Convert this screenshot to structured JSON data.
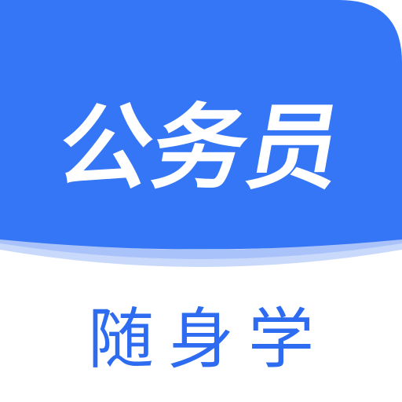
{
  "app_icon": {
    "title": "公务员",
    "subtitle": "随身学",
    "colors": {
      "brand_blue": "#3576F6",
      "page_fold_light": "#C9D9FB",
      "page_fold_mid": "#A9C3FA",
      "title_text": "#FFFFFF",
      "subtitle_text": "#2D6CF0",
      "background": "#FFFFFF"
    }
  }
}
